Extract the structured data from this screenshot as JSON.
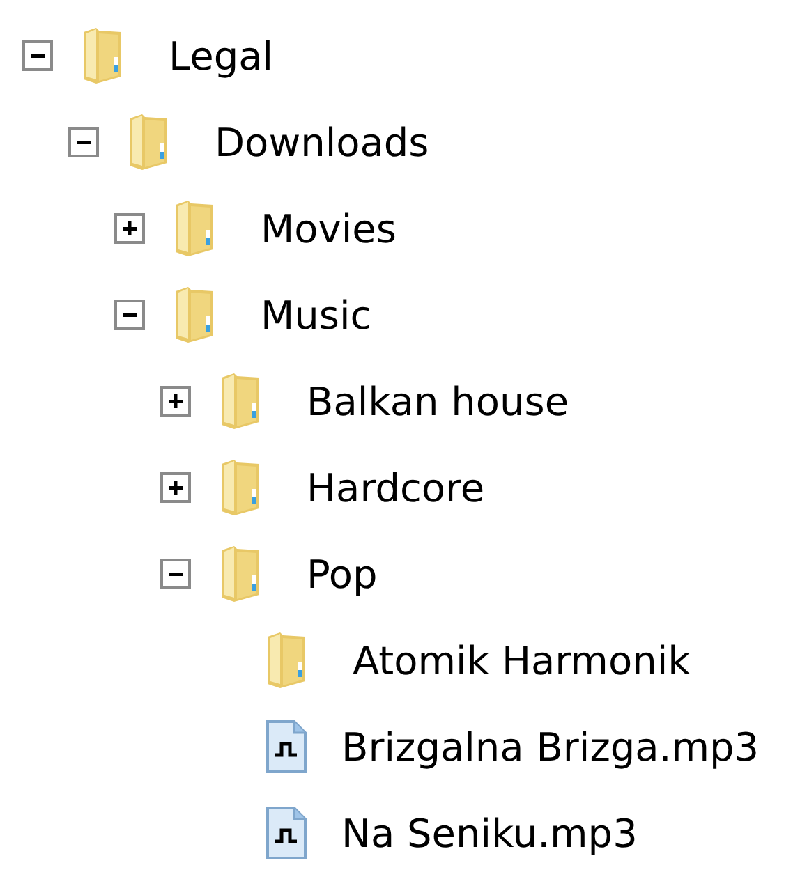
{
  "tree": [
    {
      "kind": "folder",
      "label": "Legal",
      "expanded": true,
      "children": [
        {
          "kind": "folder",
          "label": "Downloads",
          "expanded": true,
          "children": [
            {
              "kind": "folder",
              "label": "Movies",
              "expanded": false
            },
            {
              "kind": "folder",
              "label": "Music",
              "expanded": true,
              "children": [
                {
                  "kind": "folder",
                  "label": "Balkan house",
                  "expanded": false
                },
                {
                  "kind": "folder",
                  "label": "Hardcore",
                  "expanded": false
                },
                {
                  "kind": "folder",
                  "label": "Pop",
                  "expanded": true,
                  "children": [
                    {
                      "kind": "empty-folder",
                      "label": "Atomik Harmonik"
                    },
                    {
                      "kind": "audio-file",
                      "label": "Brizgalna Brizga.mp3"
                    },
                    {
                      "kind": "audio-file",
                      "label": "Na Seniku.mp3"
                    }
                  ]
                }
              ]
            }
          ]
        }
      ]
    }
  ]
}
